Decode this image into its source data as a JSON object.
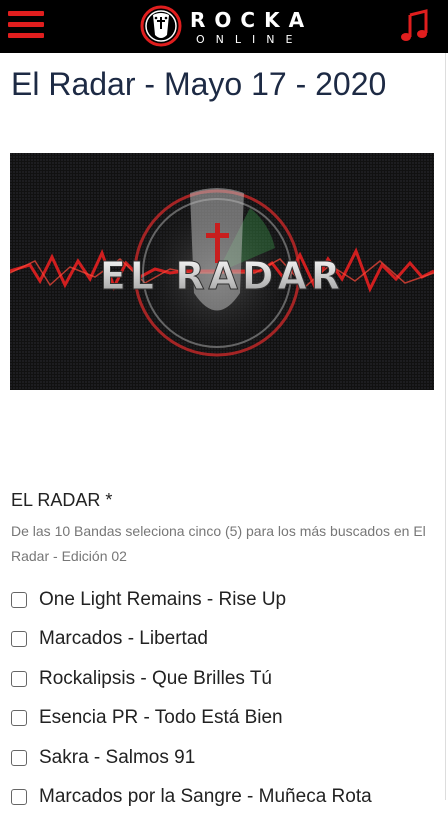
{
  "header": {
    "menu_icon": "hamburger-menu-icon",
    "logo_top": "ROCKA",
    "logo_bottom": "ONLINE",
    "music_icon": "music-note-icon",
    "accent_color": "#e01e1e",
    "bar_color": "#000000"
  },
  "article": {
    "title": "El Radar - Mayo 17 - 2020",
    "banner_text": "EL RADAR"
  },
  "form": {
    "title": "EL RADAR *",
    "description": "De las 10 Bandas seleciona cinco (5) para los más buscados en El Radar - Edición 02",
    "options": [
      {
        "label": "One Light Remains - Rise Up",
        "checked": false
      },
      {
        "label": "Marcados - Libertad",
        "checked": false
      },
      {
        "label": "Rockalipsis - Que Brilles Tú",
        "checked": false
      },
      {
        "label": "Esencia PR - Todo Está Bien",
        "checked": false
      },
      {
        "label": "Sakra - Salmos 91",
        "checked": false
      },
      {
        "label": "Marcados por la Sangre - Muñeca Rota",
        "checked": false
      }
    ]
  }
}
